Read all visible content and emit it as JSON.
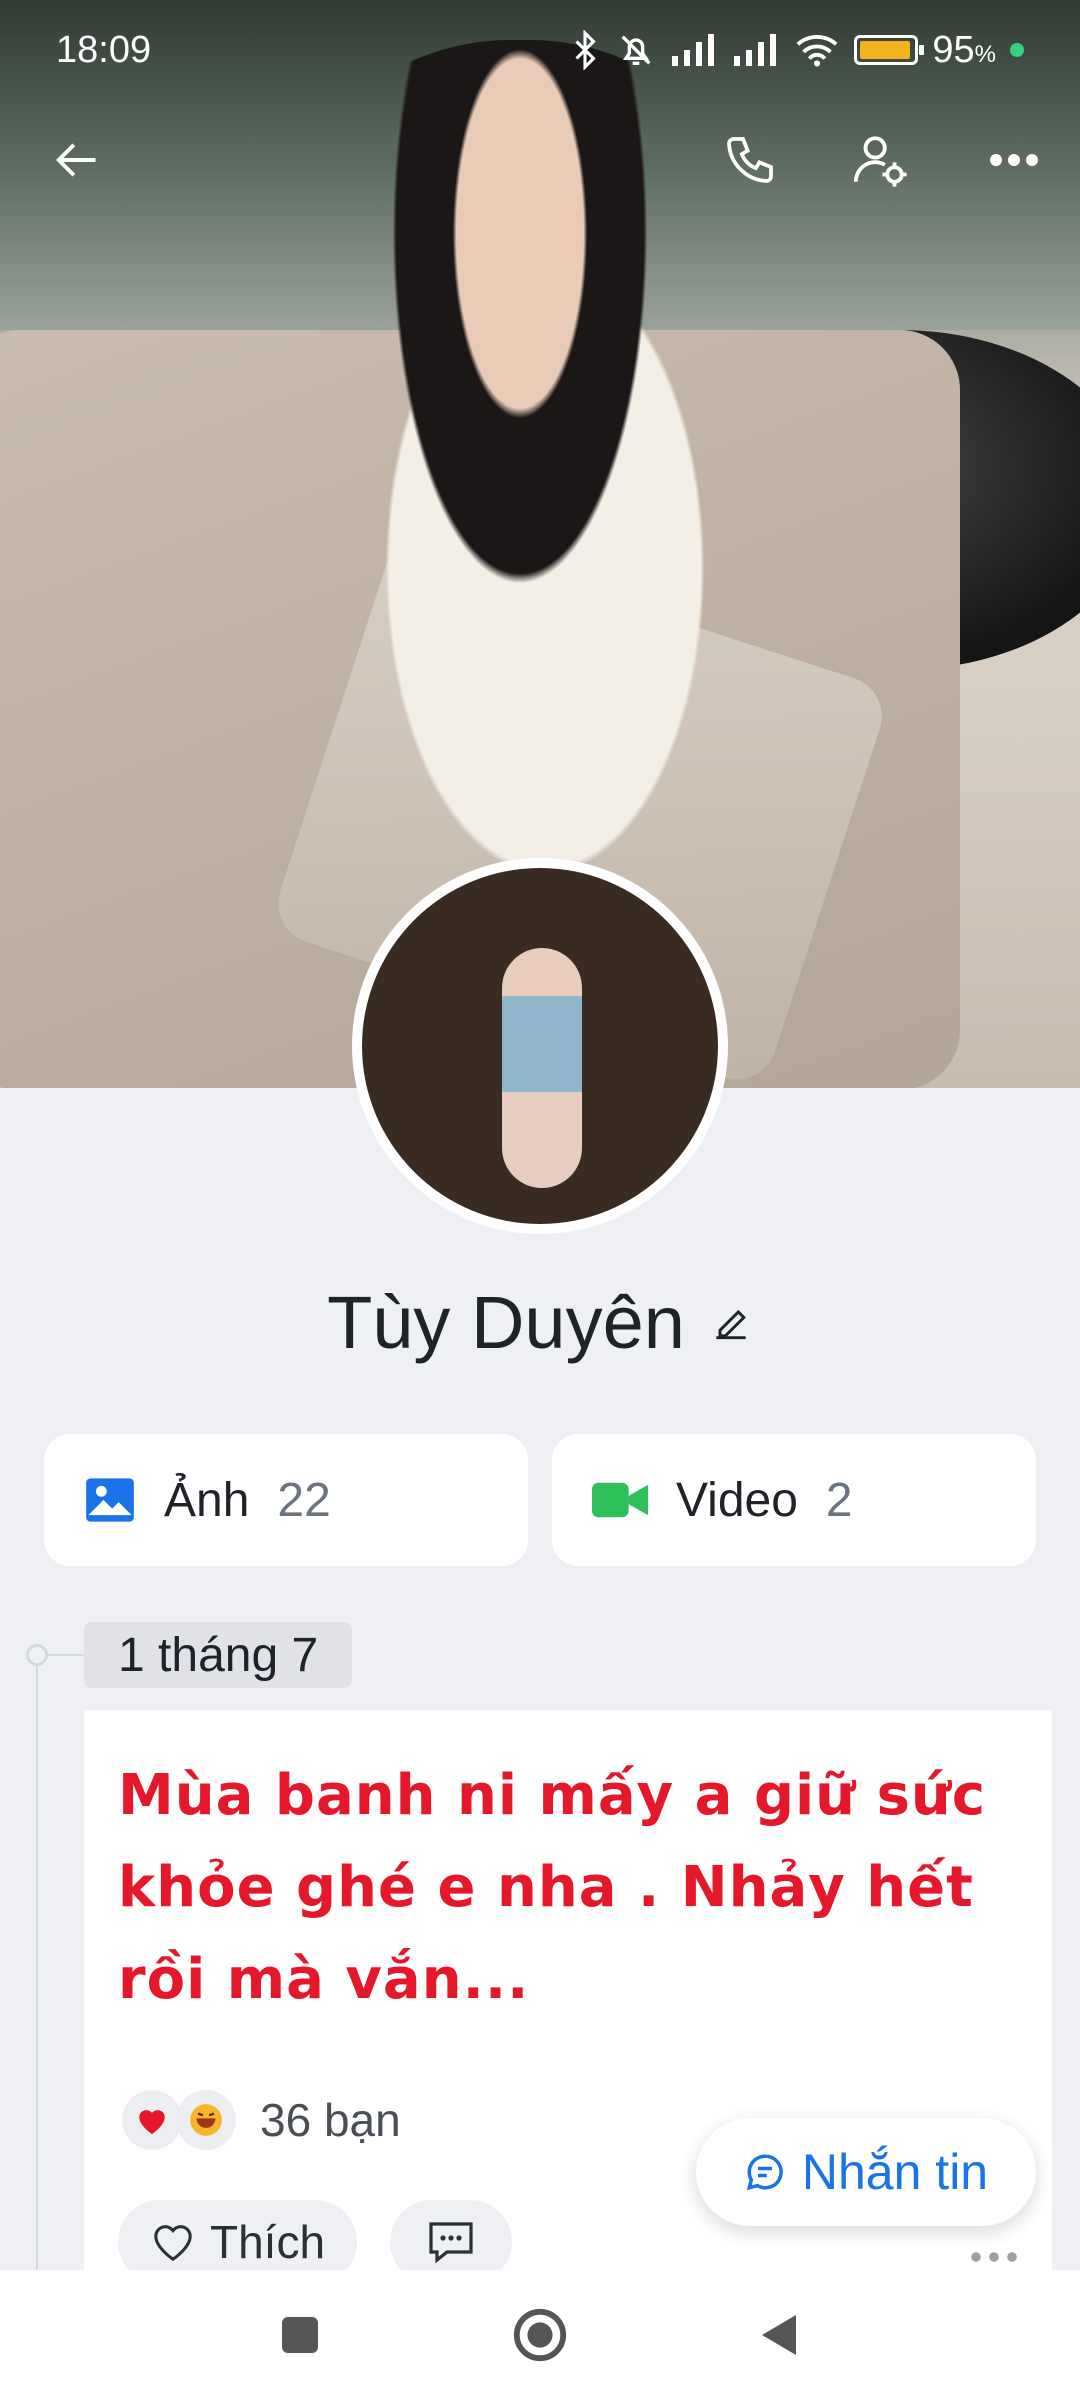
{
  "status_bar": {
    "time": "18:09",
    "battery": "95",
    "battery_level": 0.95,
    "icons": [
      "bluetooth-icon",
      "mute-icon",
      "signal-icon",
      "signal-icon",
      "wifi-icon",
      "battery-icon"
    ]
  },
  "top_nav": {
    "back": "back-arrow-icon",
    "call": "phone-icon",
    "settings": "user-settings-icon",
    "more": "more-icon"
  },
  "profile": {
    "name": "Tùy Duyên",
    "edit_icon": "pencil-icon"
  },
  "media": {
    "photos": {
      "label": "Ảnh",
      "count": "22",
      "color": "#1a73e8"
    },
    "videos": {
      "label": "Video",
      "count": "2",
      "color": "#2fbf5b"
    }
  },
  "timeline": {
    "date": "1 tháng 7",
    "post": {
      "text": "Mùa banh ni mấy a giữ sức khỏe ghé e nha . Nhảy hết rồi mà vắn...",
      "text_color": "#e5182b",
      "reactions": {
        "icons": [
          "heart-icon",
          "laugh-icon"
        ],
        "count": "36 bạn"
      },
      "like_label": "Thích"
    }
  },
  "message_button": {
    "label": "Nhắn tin",
    "color": "#1a73e8"
  }
}
